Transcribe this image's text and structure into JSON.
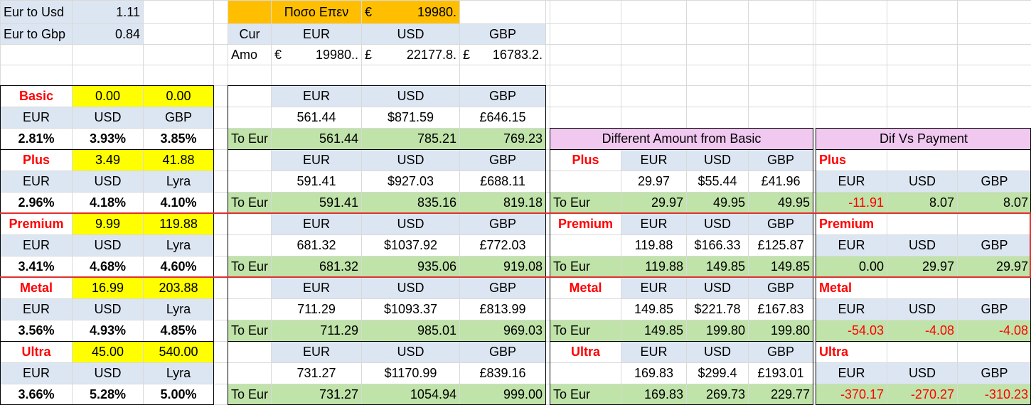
{
  "rates": [
    {
      "label": "Eur to Usd",
      "value": "1.11"
    },
    {
      "label": "Eur to Gbp",
      "value": "0.84"
    }
  ],
  "amount_box": {
    "label": "Ποσο Επεν",
    "currency_symbol": "€",
    "amount": "19980.",
    "cur_label": "Cur",
    "amo_label": "Amo",
    "headers": [
      "EUR",
      "USD",
      "GBP"
    ],
    "converted": [
      {
        "sym": "€",
        "val": "19980.."
      },
      {
        "sym": "£",
        "val": "22177.8."
      },
      {
        "sym": "£",
        "val": "16783.2."
      }
    ]
  },
  "plans": [
    {
      "name": "Basic",
      "fee_monthly": "0.00",
      "fee_yearly": "0.00",
      "cols": [
        "EUR",
        "USD",
        "GBP"
      ],
      "rates": [
        "2.81%",
        "3.93%",
        "3.85%"
      ],
      "interest": [
        "561.44",
        "$871.59",
        "£646.15"
      ],
      "to_eur": [
        "561.44",
        "785.21",
        "769.23"
      ]
    },
    {
      "name": "Plus",
      "fee_monthly": "3.49",
      "fee_yearly": "41.88",
      "cols": [
        "EUR",
        "USD",
        "Lyra"
      ],
      "rates": [
        "2.96%",
        "4.18%",
        "4.10%"
      ],
      "interest": [
        "591.41",
        "$927.03",
        "£688.11"
      ],
      "to_eur": [
        "591.41",
        "835.16",
        "819.18"
      ]
    },
    {
      "name": "Premium",
      "fee_monthly": "9.99",
      "fee_yearly": "119.88",
      "cols": [
        "EUR",
        "USD",
        "Lyra"
      ],
      "rates": [
        "3.41%",
        "4.68%",
        "4.60%"
      ],
      "interest": [
        "681.32",
        "$1037.92",
        "£772.03"
      ],
      "to_eur": [
        "681.32",
        "935.06",
        "919.08"
      ]
    },
    {
      "name": "Metal",
      "fee_monthly": "16.99",
      "fee_yearly": "203.88",
      "cols": [
        "EUR",
        "USD",
        "Lyra"
      ],
      "rates": [
        "3.56%",
        "4.93%",
        "4.85%"
      ],
      "interest": [
        "711.29",
        "$1093.37",
        "£813.99"
      ],
      "to_eur": [
        "711.29",
        "985.01",
        "969.03"
      ]
    },
    {
      "name": "Ultra",
      "fee_monthly": "45.00",
      "fee_yearly": "540.00",
      "cols": [
        "EUR",
        "USD",
        "Lyra"
      ],
      "rates": [
        "3.66%",
        "5.28%",
        "5.00%"
      ],
      "interest": [
        "731.27",
        "$1170.99",
        "£839.16"
      ],
      "to_eur": [
        "731.27",
        "1054.94",
        "999.00"
      ]
    }
  ],
  "table_headers": [
    "EUR",
    "USD",
    "GBP"
  ],
  "to_eur_label": "To Eur",
  "diff_title": "Different Amount from Basic",
  "diffs": [
    {
      "name": "Plus",
      "amounts": [
        "29.97",
        "$55.44",
        "£41.96"
      ],
      "to_eur": [
        "29.97",
        "49.95",
        "49.95"
      ]
    },
    {
      "name": "Premium",
      "amounts": [
        "119.88",
        "$166.33",
        "£125.87"
      ],
      "to_eur": [
        "119.88",
        "149.85",
        "149.85"
      ]
    },
    {
      "name": "Metal",
      "amounts": [
        "149.85",
        "$221.78",
        "£167.83"
      ],
      "to_eur": [
        "149.85",
        "199.80",
        "199.80"
      ]
    },
    {
      "name": "Ultra",
      "amounts": [
        "169.83",
        "$299.4",
        "£193.01"
      ],
      "to_eur": [
        "169.83",
        "269.73",
        "229.77"
      ]
    }
  ],
  "payment_title": "Dif Vs Payment",
  "payments": [
    {
      "name": "Plus",
      "values": [
        "-11.91",
        "8.07",
        "8.07"
      ]
    },
    {
      "name": "Premium",
      "values": [
        "0.00",
        "29.97",
        "29.97"
      ]
    },
    {
      "name": "Metal",
      "values": [
        "-54.03",
        "-4.08",
        "-4.08"
      ]
    },
    {
      "name": "Ultra",
      "values": [
        "-370.17",
        "-270.27",
        "-310.23"
      ]
    }
  ],
  "colors": {
    "plan_name": "#ff0000",
    "fee_fill": "#ffff00",
    "header_fill": "#dce6f2",
    "to_eur_fill": "#bfe3a8",
    "title_fill": "#f0c8f0",
    "amount_fill": "#ffbf00",
    "negative": "#ff0000"
  }
}
